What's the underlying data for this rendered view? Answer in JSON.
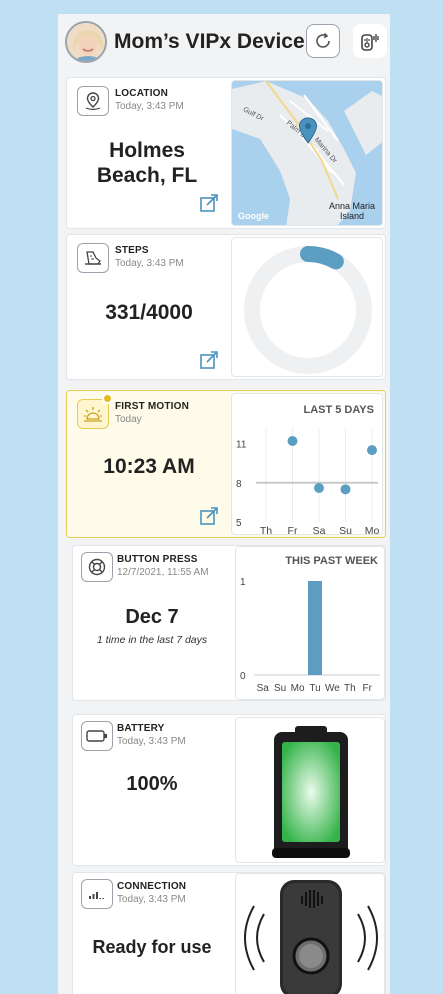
{
  "header": {
    "title": "Mom’s VIPx Device"
  },
  "location": {
    "title": "LOCATION",
    "timestamp": "Today, 3:43 PM",
    "city": "Holmes",
    "state": "Beach, FL",
    "map_labels": {
      "road1": "Gulf Dr",
      "road2": "Palm Dr",
      "road3": "Marina Dr",
      "island_line1": "Anna Maria",
      "island_line2": "Island",
      "brand": "Google"
    }
  },
  "steps": {
    "title": "STEPS",
    "timestamp": "Today, 3:43 PM",
    "value": "331/4000",
    "current": 331,
    "goal": 4000
  },
  "first_motion": {
    "title": "FIRST MOTION",
    "timestamp": "Today",
    "value": "10:23 AM",
    "chart_title": "LAST 5 DAYS"
  },
  "button_press": {
    "title": "BUTTON PRESS",
    "timestamp": "12/7/2021, 11:55 AM",
    "value": "Dec 7",
    "note": "1 time in the last 7 days",
    "chart_title": "THIS PAST WEEK"
  },
  "battery": {
    "title": "BATTERY",
    "timestamp": "Today, 3:43 PM",
    "value": "100%",
    "level": 1.0
  },
  "connection": {
    "title": "CONNECTION",
    "timestamp": "Today, 3:43 PM",
    "value": "Ready for use"
  },
  "colors": {
    "accent": "#5b9ec2",
    "highlight_border": "#e8cb55",
    "battery_green": "#35b34a",
    "background": "#bfe0f2"
  },
  "chart_data": [
    {
      "type": "scatter",
      "title": "LAST 5 DAYS",
      "categories": [
        "Th",
        "Fr",
        "Sa",
        "Su",
        "Mo"
      ],
      "values": [
        null,
        11.2,
        7.6,
        7.5,
        10.5
      ],
      "yticks": [
        "5",
        "8",
        "11"
      ],
      "ylim": [
        5,
        12.5
      ],
      "reference_line": 8,
      "grid": true
    },
    {
      "type": "bar",
      "title": "THIS PAST WEEK",
      "categories": [
        "Sa",
        "Su",
        "Mo",
        "Tu",
        "We",
        "Th",
        "Fr"
      ],
      "values": [
        0,
        0,
        0,
        1,
        0,
        0,
        0
      ],
      "yticks": [
        "0",
        "1"
      ],
      "ylim": [
        0,
        1
      ]
    }
  ]
}
